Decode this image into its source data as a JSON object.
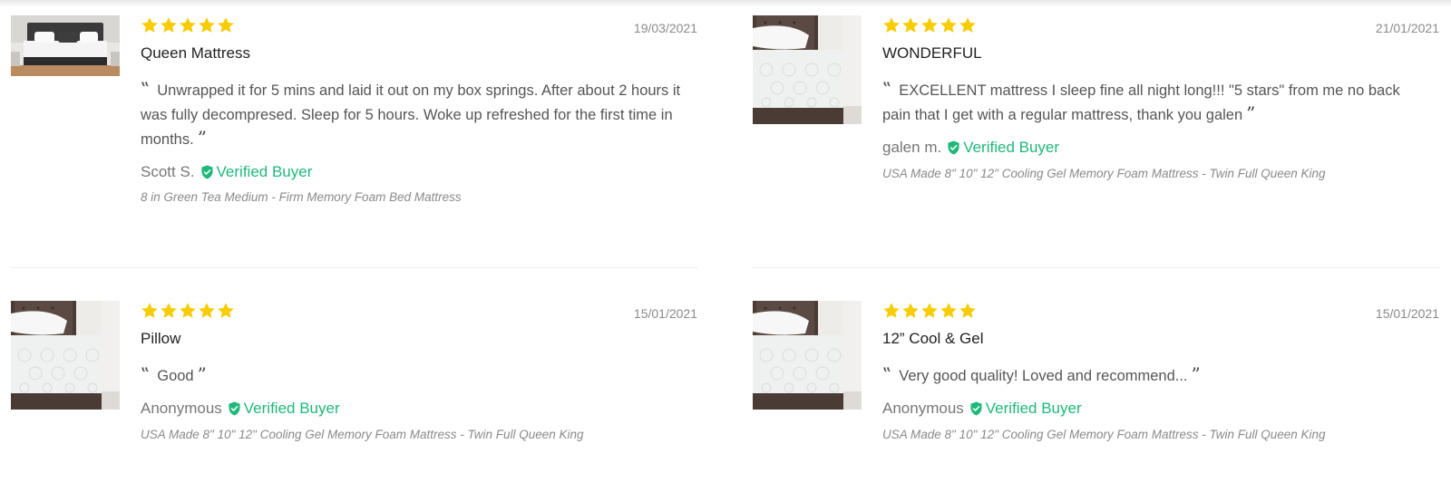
{
  "rating": 5,
  "colors": {
    "star": "#f7cc00",
    "verified": "#1fb87a",
    "divider": "#ececec"
  },
  "icons": {
    "star": "star-icon",
    "verified": "shield-check-icon",
    "quote_open": "open-quote-icon",
    "quote_close": "close-quote-icon"
  },
  "verified_label": "Verified Buyer",
  "quote_open": "‟",
  "quote_close": "”",
  "reviews": [
    {
      "date": "19/03/2021",
      "title": "Queen Mattress",
      "body": "Unwrapped it for 5 mins and laid it out on my box springs. After about 2 hours it was fully decompresed. Sleep for 5 hours. Woke up refreshed for the first time in months.",
      "author": "Scott S.",
      "product": "8 in Green Tea Medium - Firm Memory Foam Bed Mattress",
      "image": "dark-bedroom-mattress-photo"
    },
    {
      "date": "21/01/2021",
      "title": "WONDERFUL",
      "body": "EXCELLENT mattress I sleep fine all night long!!! \"5 stars\" from me no back pain that I get with a regular mattress, thank you galen",
      "author": "galen m.",
      "product": "USA Made 8\" 10\" 12\" Cooling Gel Memory Foam Mattress - Twin Full Queen King",
      "image": "white-mattress-photo"
    },
    {
      "date": "15/01/2021",
      "title": "Pillow",
      "body": "Good",
      "author": "Anonymous",
      "product": "USA Made 8\" 10\" 12\" Cooling Gel Memory Foam Mattress - Twin Full Queen King",
      "image": "white-mattress-photo"
    },
    {
      "date": "15/01/2021",
      "title": "12” Cool & Gel",
      "body": "Very good quality! Loved and recommend...",
      "author": "Anonymous",
      "product": "USA Made 8\" 10\" 12\" Cooling Gel Memory Foam Mattress - Twin Full Queen King",
      "image": "white-mattress-photo"
    }
  ]
}
